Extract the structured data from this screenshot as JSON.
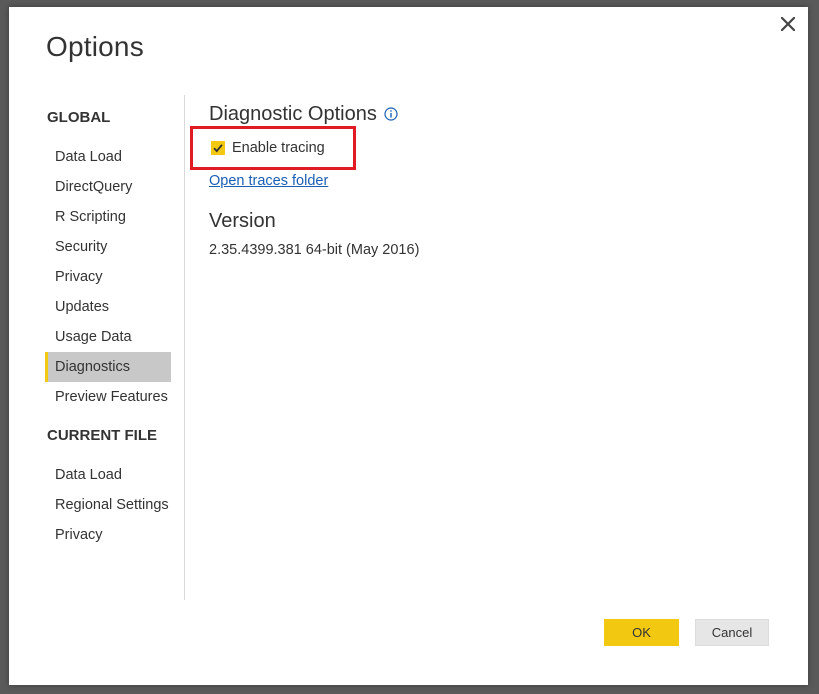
{
  "dialog": {
    "title": "Options",
    "close_icon": "close-icon"
  },
  "nav": {
    "global_heading": "GLOBAL",
    "global_items": [
      {
        "label": "Data Load"
      },
      {
        "label": "DirectQuery"
      },
      {
        "label": "R Scripting"
      },
      {
        "label": "Security"
      },
      {
        "label": "Privacy"
      },
      {
        "label": "Updates"
      },
      {
        "label": "Usage Data"
      },
      {
        "label": "Diagnostics",
        "selected": true
      },
      {
        "label": "Preview Features"
      }
    ],
    "current_file_heading": "CURRENT FILE",
    "current_file_items": [
      {
        "label": "Data Load"
      },
      {
        "label": "Regional Settings"
      },
      {
        "label": "Privacy"
      }
    ]
  },
  "content": {
    "diagnostic_heading": "Diagnostic Options",
    "info_icon": "info-icon",
    "enable_tracing_label": "Enable tracing",
    "enable_tracing_checked": true,
    "open_traces_link": "Open traces folder",
    "version_heading": "Version",
    "version_text": "2.35.4399.381 64-bit (May 2016)"
  },
  "buttons": {
    "ok_label": "OK",
    "cancel_label": "Cancel"
  },
  "colors": {
    "accent": "#f2c811",
    "highlight_border": "#e01b24",
    "link": "#1a5fb4",
    "selected_bg": "#c8c8c8"
  }
}
